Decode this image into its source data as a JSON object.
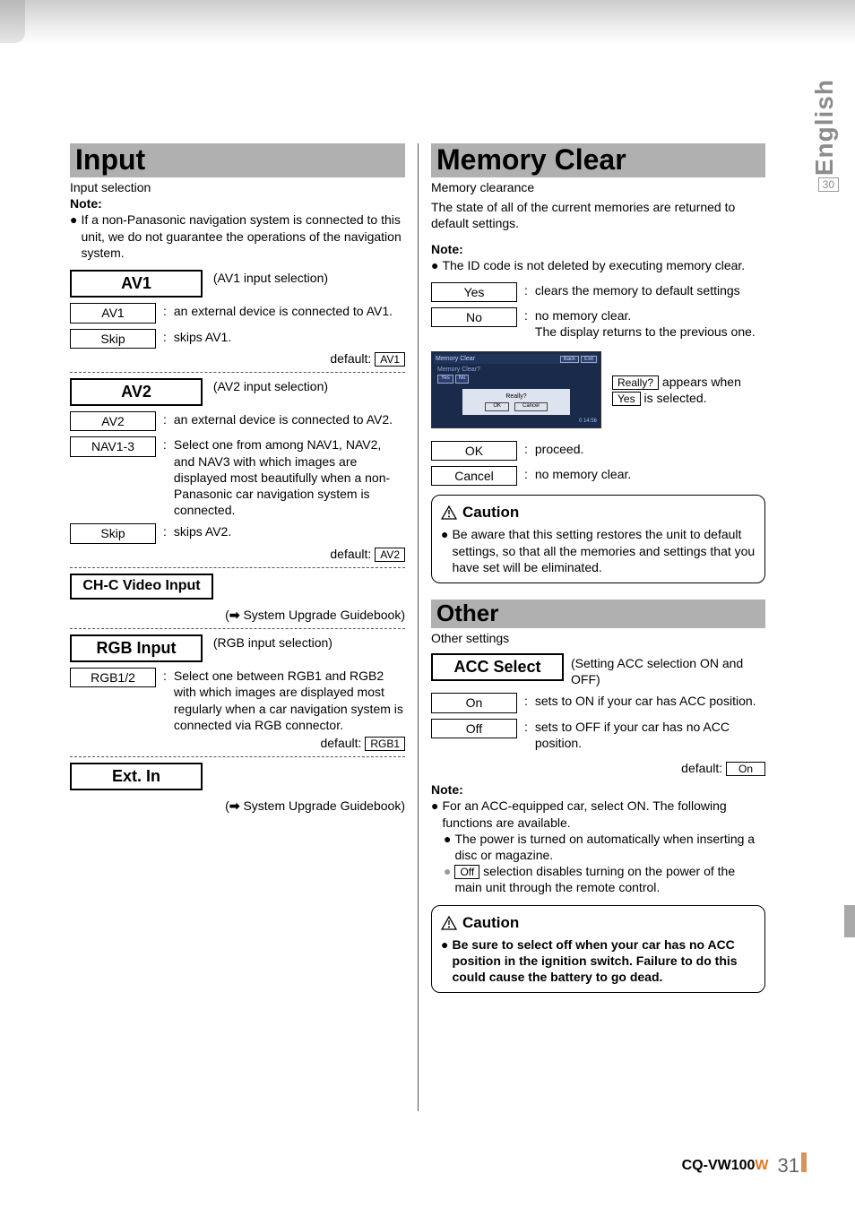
{
  "side": {
    "language": "English",
    "side_page": "30"
  },
  "footer": {
    "code_black": "CQ-VW100",
    "code_orange": "W",
    "page": "31"
  },
  "input": {
    "title": "Input",
    "subtitle": "Input selection",
    "note_label": "Note:",
    "note_text": "If a non-Panasonic navigation system is connected to this unit, we do not guarantee the operations of the navigation system.",
    "av1": {
      "header": "AV1",
      "paren": "(AV1 input selection)",
      "opt_av1": "AV1",
      "opt_av1_desc": "an external device is connected to AV1.",
      "opt_skip": "Skip",
      "opt_skip_desc": "skips AV1.",
      "default_label": "default:",
      "default_value": "AV1"
    },
    "av2": {
      "header": "AV2",
      "paren": "(AV2 input selection)",
      "opt_av2": "AV2",
      "opt_av2_desc": "an external device is connected to AV2.",
      "opt_nav": "NAV1-3",
      "opt_nav_desc": "Select one from among NAV1, NAV2, and NAV3 with which images are displayed most beautifully when a non-Panasonic car navigation system is connected.",
      "opt_skip": "Skip",
      "opt_skip_desc": "skips AV2.",
      "default_label": "default:",
      "default_value": "AV2"
    },
    "chc": {
      "header": "CH-C Video Input",
      "ref": "System Upgrade Guidebook)"
    },
    "rgb": {
      "header": "RGB Input",
      "paren": "(RGB input selection)",
      "opt": "RGB1/2",
      "opt_desc": "Select one between RGB1 and RGB2 with which images are displayed most regularly when a car navigation system is connected via RGB connector.",
      "default_label": "default:",
      "default_value": "RGB1"
    },
    "ext": {
      "header": "Ext. In",
      "ref": "System Upgrade Guidebook)"
    }
  },
  "memory": {
    "title": "Memory Clear",
    "subtitle": "Memory clearance",
    "intro": "The state of all of the current memories are returned to default settings.",
    "note_label": "Note:",
    "note_text": "The ID code is not deleted by executing memory clear.",
    "yes": "Yes",
    "yes_desc": "clears the memory to default settings",
    "no": "No",
    "no_desc1": "no memory clear.",
    "no_desc2": "The display returns to the previous one.",
    "shot": {
      "title": "Memory Clear",
      "back": "Back",
      "exit": "Exit",
      "q": "Memory Clear?",
      "byes": "Yes",
      "bno": "No",
      "really": "Really?",
      "ok": "OK",
      "cancel": "Cancel",
      "time": "0 14:56"
    },
    "side_really": "Really?",
    "side_text1": " appears when ",
    "side_yes": "Yes",
    "side_text2": " is selected.",
    "ok": "OK",
    "ok_desc": "proceed.",
    "cancel": "Cancel",
    "cancel_desc": "no memory clear.",
    "caution_head": "Caution",
    "caution_text": "Be aware that this setting restores the unit to default settings, so that all the memories and settings that you have set will be eliminated."
  },
  "other": {
    "title": "Other",
    "subtitle": "Other settings",
    "acc": {
      "header": "ACC Select",
      "paren": "(Setting ACC selection ON and OFF)",
      "on": "On",
      "on_desc": "sets to ON if your car has ACC position.",
      "off": "Off",
      "off_desc": "sets to OFF if your car has no ACC position.",
      "default_label": "default:",
      "default_value": "On"
    },
    "note_label": "Note:",
    "note1": "For an ACC-equipped car, select ON.  The following functions are available.",
    "note1a": "The power is turned on automatically when inserting a disc or magazine.",
    "note1b_box": "Off",
    "note1b_rest": "selection disables turning on the power of the main unit through the remote control.",
    "caution_head": "Caution",
    "caution_text": "Be sure to select off when your car has no ACC position in the ignition switch. Failure to do this could cause the battery to go dead."
  }
}
